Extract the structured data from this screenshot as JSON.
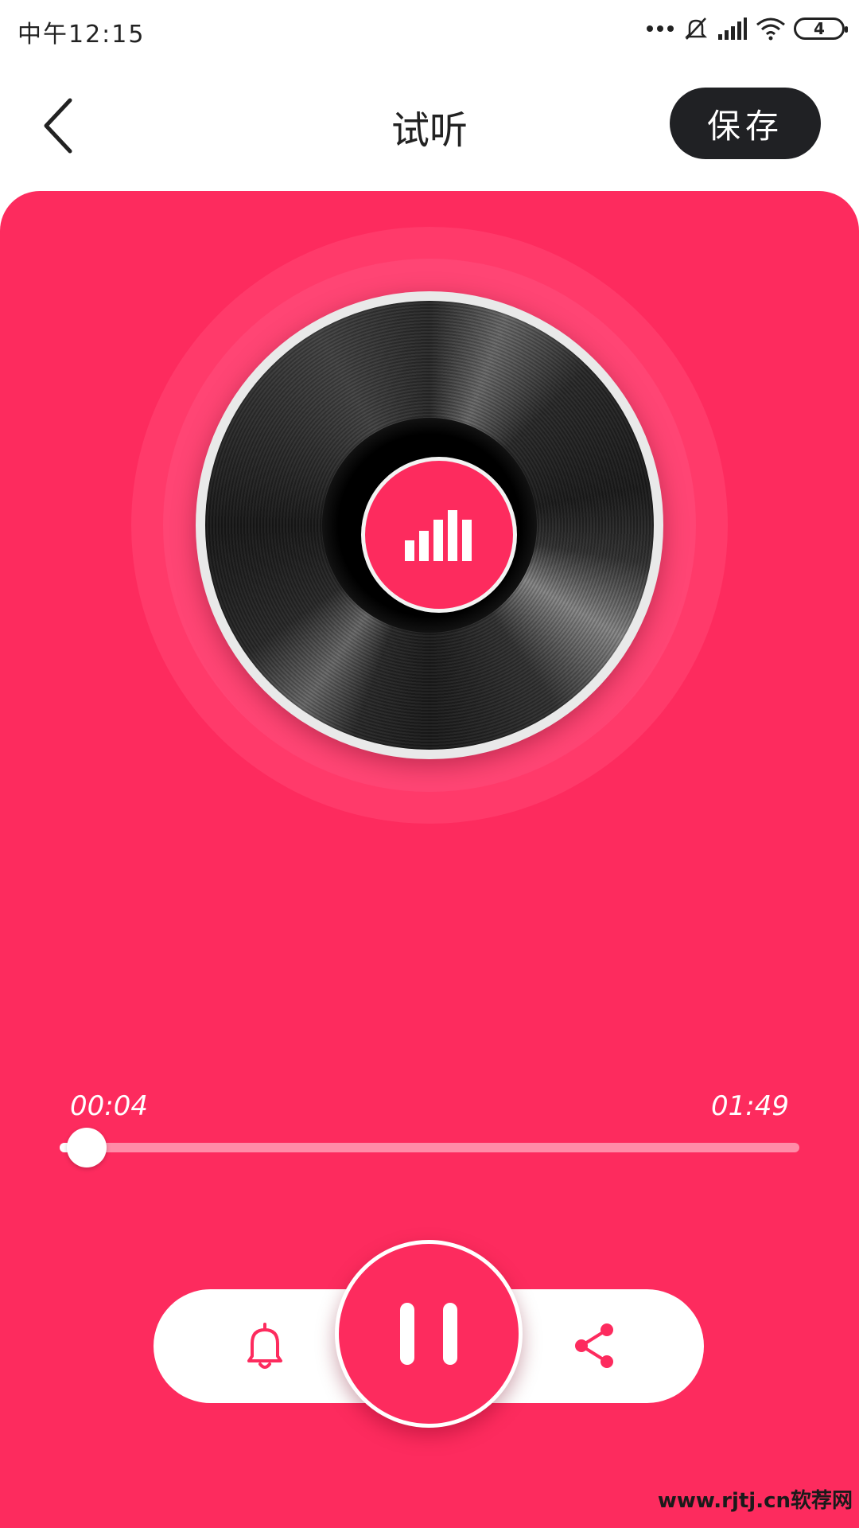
{
  "status_bar": {
    "time": "中午12:15",
    "battery_level": "4",
    "icons": [
      "more-dots-icon",
      "bell-off-icon",
      "signal-icon",
      "wifi-icon",
      "battery-icon"
    ]
  },
  "header": {
    "title": "试听",
    "save_label": "保存",
    "back_icon": "chevron-left-icon"
  },
  "player": {
    "current_time": "00:04",
    "total_time": "01:49",
    "progress_fraction": 0.037,
    "center_icon": "equalizer-bars-icon",
    "controls": {
      "left_icon": "bell-icon",
      "main_icon": "pause-icon",
      "right_icon": "share-icon"
    }
  },
  "colors": {
    "accent": "#fd2b5e",
    "save_button_bg": "#202124",
    "track_bg": "#ff8ca8"
  },
  "watermark": "www.rjtj.cn软荐网"
}
